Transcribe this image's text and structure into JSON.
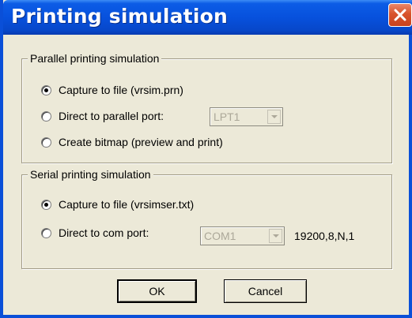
{
  "window": {
    "title": "Printing simulation"
  },
  "parallel": {
    "legend": "Parallel printing simulation",
    "options": [
      {
        "label": "Capture to file (vrsim.prn)",
        "checked": true
      },
      {
        "label": "Direct to parallel port:",
        "checked": false
      },
      {
        "label": "Create bitmap (preview and print)",
        "checked": false
      }
    ],
    "port_select": {
      "value": "LPT1",
      "enabled": false
    }
  },
  "serial": {
    "legend": "Serial printing simulation",
    "options": [
      {
        "label": "Capture to file (vrsimser.txt)",
        "checked": true
      },
      {
        "label": "Direct to com port:",
        "checked": false
      }
    ],
    "port_select": {
      "value": "COM1",
      "enabled": false
    },
    "settings": "19200,8,N,1"
  },
  "buttons": {
    "ok": "OK",
    "cancel": "Cancel"
  },
  "icons": {
    "close": "close-icon",
    "dropdown": "chevron-down-icon"
  }
}
